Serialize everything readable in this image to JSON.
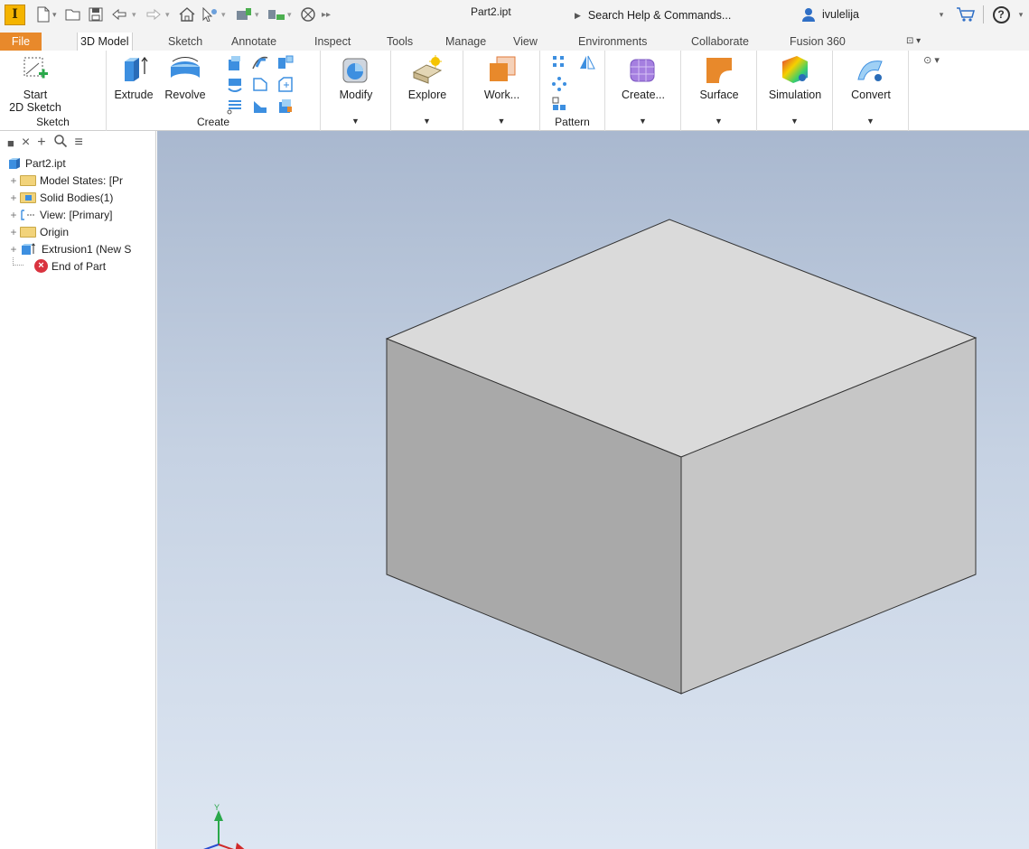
{
  "titlebar": {
    "app_letter": "I",
    "document_title": "Part2.ipt",
    "search_placeholder": "Search Help & Commands...",
    "username": "ivulelija",
    "help_symbol": "?"
  },
  "tabs": [
    {
      "label": "File"
    },
    {
      "label": "3D Model"
    },
    {
      "label": "Sketch"
    },
    {
      "label": "Annotate"
    },
    {
      "label": "Inspect"
    },
    {
      "label": "Tools"
    },
    {
      "label": "Manage"
    },
    {
      "label": "View"
    },
    {
      "label": "Environments"
    },
    {
      "label": "Collaborate"
    },
    {
      "label": "Fusion 360"
    }
  ],
  "ribbon": {
    "sketch_group": {
      "start_line1": "Start",
      "start_line2": "2D Sketch",
      "label": "Sketch"
    },
    "create_group": {
      "extrude": "Extrude",
      "revolve": "Revolve",
      "label": "Create"
    },
    "modify": "Modify",
    "explore": "Explore",
    "work": "Work...",
    "pattern_label": "Pattern",
    "create_freeform": "Create...",
    "surface": "Surface",
    "simulation": "Simulation",
    "convert": "Convert"
  },
  "browser": {
    "root": "Part2.ipt",
    "items": [
      {
        "label": "Model States: [Pr"
      },
      {
        "label": "Solid Bodies(1)"
      },
      {
        "label": "View: [Primary]"
      },
      {
        "label": "Origin"
      },
      {
        "label": "Extrusion1 (New S"
      },
      {
        "label": "End of Part"
      }
    ]
  },
  "viewport": {
    "triad_y_label": "Y"
  },
  "colors": {
    "file_tab": "#e8892b",
    "cube_top": "#dadada",
    "cube_left": "#a9a9a9",
    "cube_right": "#c6c6c6",
    "end_of_part_icon": "#d9333f"
  }
}
